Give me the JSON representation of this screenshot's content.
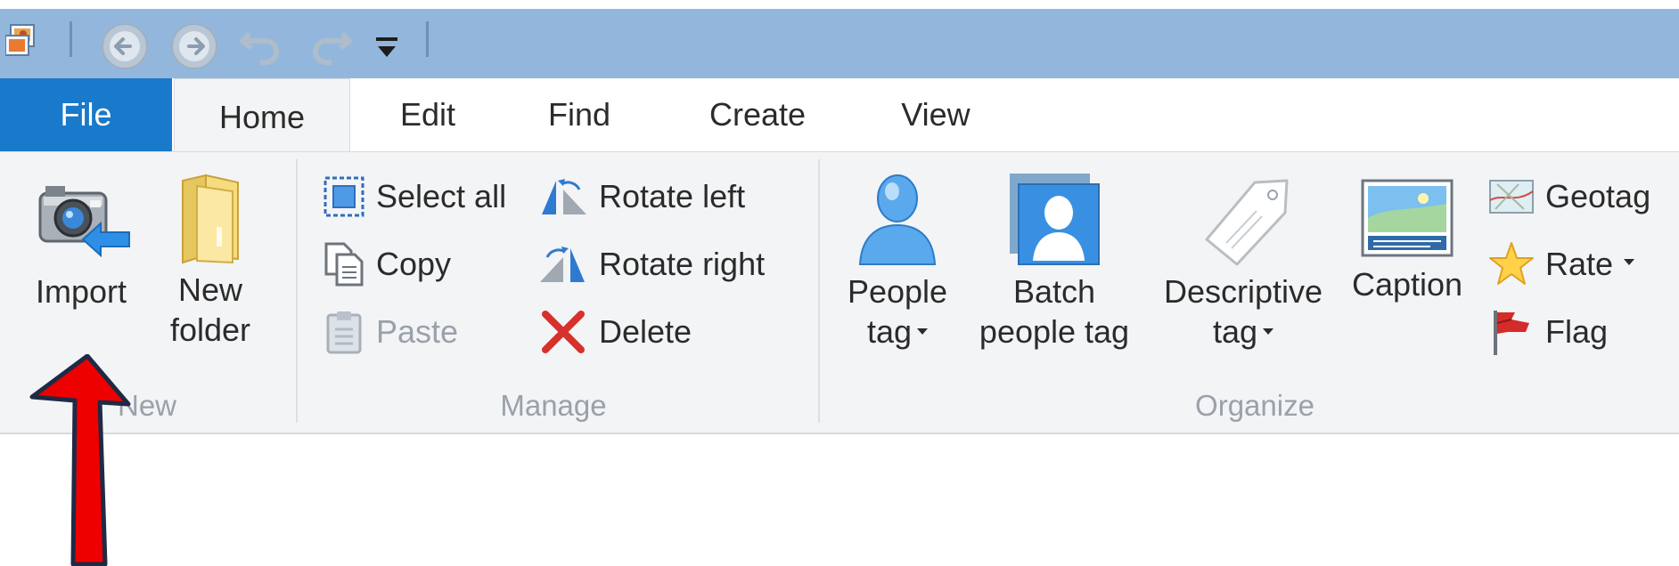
{
  "quick_access": {
    "items": [
      {
        "name": "app-icon"
      },
      {
        "name": "back-icon"
      },
      {
        "name": "forward-icon"
      },
      {
        "name": "undo-icon"
      },
      {
        "name": "redo-icon"
      },
      {
        "name": "customize-dropdown-icon"
      }
    ],
    "bar_color": "#93b7dc"
  },
  "tabs": [
    {
      "label": "File",
      "active": false,
      "accent": "#1979ca"
    },
    {
      "label": "Home",
      "active": true
    },
    {
      "label": "Edit",
      "active": false
    },
    {
      "label": "Find",
      "active": false
    },
    {
      "label": "Create",
      "active": false
    },
    {
      "label": "View",
      "active": false
    }
  ],
  "ribbon": {
    "groups": {
      "new": {
        "label": "New",
        "import_label": "Import",
        "new_folder_label_line1": "New",
        "new_folder_label_line2": "folder"
      },
      "manage": {
        "label": "Manage",
        "select_all": "Select all",
        "copy": "Copy",
        "paste": "Paste",
        "rotate_left": "Rotate left",
        "rotate_right": "Rotate right",
        "delete": "Delete"
      },
      "organize": {
        "label": "Organize",
        "people_tag_line1": "People",
        "people_tag_line2": "tag",
        "batch_people_tag_line1": "Batch",
        "batch_people_tag_line2": "people tag",
        "descriptive_tag_line1": "Descriptive",
        "descriptive_tag_line2": "tag",
        "caption": "Caption",
        "geotag": "Geotag",
        "rate": "Rate",
        "flag": "Flag"
      }
    }
  },
  "annotation": {
    "arrow_color": "#ee0000",
    "points_to": "Import"
  }
}
